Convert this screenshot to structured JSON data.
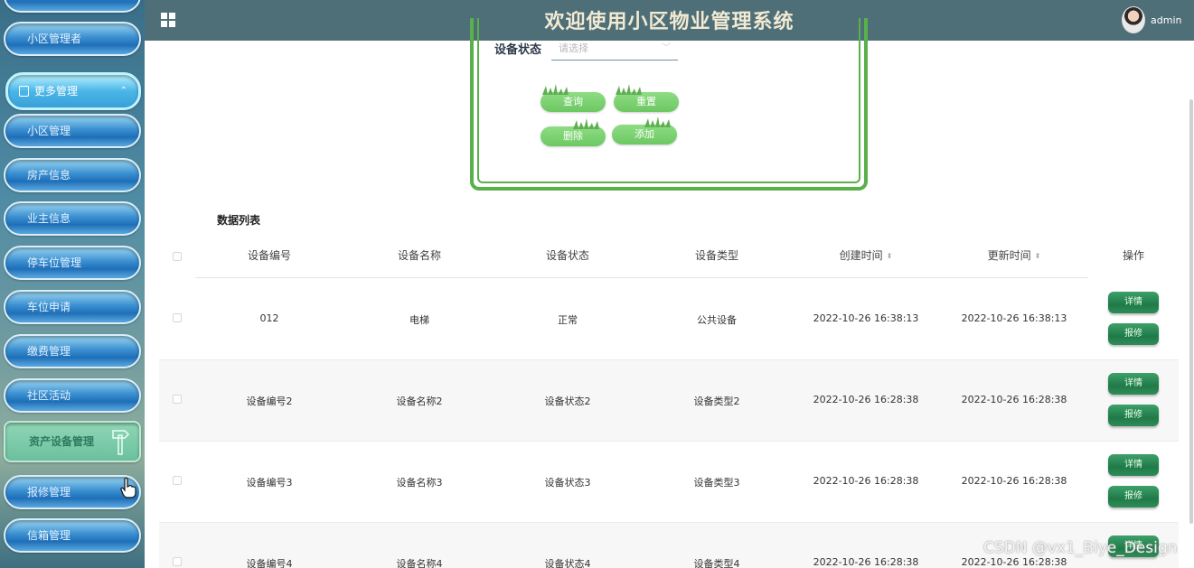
{
  "header": {
    "title": "欢迎使用小区物业管理系统",
    "username": "admin"
  },
  "sidebar": {
    "items": [
      {
        "label": ""
      },
      {
        "label": "小区管理者"
      },
      {
        "label": "更多管理"
      },
      {
        "label": "小区管理"
      },
      {
        "label": "房产信息"
      },
      {
        "label": "业主信息"
      },
      {
        "label": "停车位管理"
      },
      {
        "label": "车位申请"
      },
      {
        "label": "缴费管理"
      },
      {
        "label": "社区活动"
      },
      {
        "label": "资产设备管理"
      },
      {
        "label": "报修管理"
      },
      {
        "label": "信箱管理"
      }
    ]
  },
  "search": {
    "status_label": "设备状态",
    "status_placeholder": "请选择",
    "query_btn": "查询",
    "reset_btn": "重置",
    "delete_btn": "删除",
    "add_btn": "添加"
  },
  "table": {
    "title": "数据列表",
    "headers": [
      "设备编号",
      "设备名称",
      "设备状态",
      "设备类型",
      "创建时间",
      "更新时间",
      "操作"
    ],
    "rows": [
      {
        "code": "012",
        "name": "电梯",
        "status": "正常",
        "type": "公共设备",
        "created": "2022-10-26 16:38:13",
        "updated": "2022-10-26 16:38:13"
      },
      {
        "code": "设备编号2",
        "name": "设备名称2",
        "status": "设备状态2",
        "type": "设备类型2",
        "created": "2022-10-26 16:28:38",
        "updated": "2022-10-26 16:28:38"
      },
      {
        "code": "设备编号3",
        "name": "设备名称3",
        "status": "设备状态3",
        "type": "设备类型3",
        "created": "2022-10-26 16:28:38",
        "updated": "2022-10-26 16:28:38"
      },
      {
        "code": "设备编号4",
        "name": "设备名称4",
        "status": "设备状态4",
        "type": "设备类型4",
        "created": "2022-10-26 16:28:38",
        "updated": "2022-10-26 16:28:38"
      }
    ],
    "actions": {
      "detail": "详情",
      "repair": "报修"
    }
  },
  "watermark": "CSDN @vx1_Biye_Design"
}
